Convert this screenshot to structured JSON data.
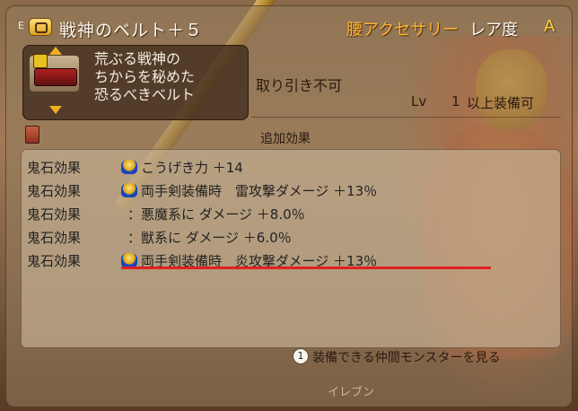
{
  "header": {
    "key_hint": "E",
    "item_name": "戦神のベルト＋５",
    "category": "腰アクセサリー",
    "rarity_label": "レア度",
    "rarity_value": "A"
  },
  "item": {
    "description_lines": [
      "荒ぶる戦神の",
      "ちからを秘めた",
      "恐るべきベルト"
    ],
    "trade_status": "取り引き不可",
    "level_label": "Lv",
    "level_value": "1",
    "level_suffix": "以上装備可"
  },
  "additional_effects": {
    "title": "追加効果",
    "rows": [
      {
        "label": "鬼石効果",
        "has_icon": true,
        "text": "こうげき力 ＋14"
      },
      {
        "label": "鬼石効果",
        "has_icon": true,
        "text": "両手剣装備時　雷攻撃ダメージ ＋13％"
      },
      {
        "label": "鬼石効果",
        "has_icon": false,
        "text": "悪魔系に ダメージ ＋8.0％"
      },
      {
        "label": "鬼石効果",
        "has_icon": false,
        "text": "獣系に ダメージ ＋6.0％"
      },
      {
        "label": "鬼石効果",
        "has_icon": true,
        "text": "両手剣装備時　炎攻撃ダメージ ＋13％"
      }
    ],
    "colon": "："
  },
  "footer": {
    "button_num": "1",
    "action_text": "装備できる仲間モンスターを見る",
    "bottom_text": "イレブン"
  },
  "colors": {
    "category": "#ffb330",
    "rarity_value": "#ffd040",
    "highlight_underline": "#e02020"
  }
}
